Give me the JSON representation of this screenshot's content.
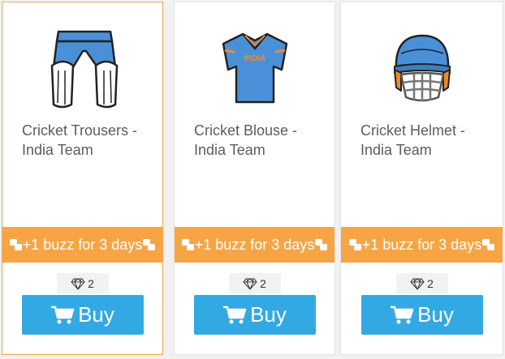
{
  "products": [
    {
      "title": "Cricket Trousers - India Team",
      "promo": "+1 buzz for 3 days",
      "price": "2",
      "buy_label": "Buy",
      "icon": "cricket-trousers-icon"
    },
    {
      "title": "Cricket Blouse - India Team",
      "promo": "+1 buzz for 3 days",
      "price": "2",
      "buy_label": "Buy",
      "icon": "cricket-blouse-icon"
    },
    {
      "title": "Cricket Helmet - India Team",
      "promo": "+1 buzz for 3 days",
      "price": "2",
      "buy_label": "Buy",
      "icon": "cricket-helmet-icon"
    }
  ],
  "jersey_text": "INDIA",
  "colors": {
    "promo": "#f7a544",
    "buy": "#33a9e3",
    "selected_border": "#f5a54a",
    "jersey_blue": "#4a90d9",
    "accent_orange": "#f08a2c"
  }
}
